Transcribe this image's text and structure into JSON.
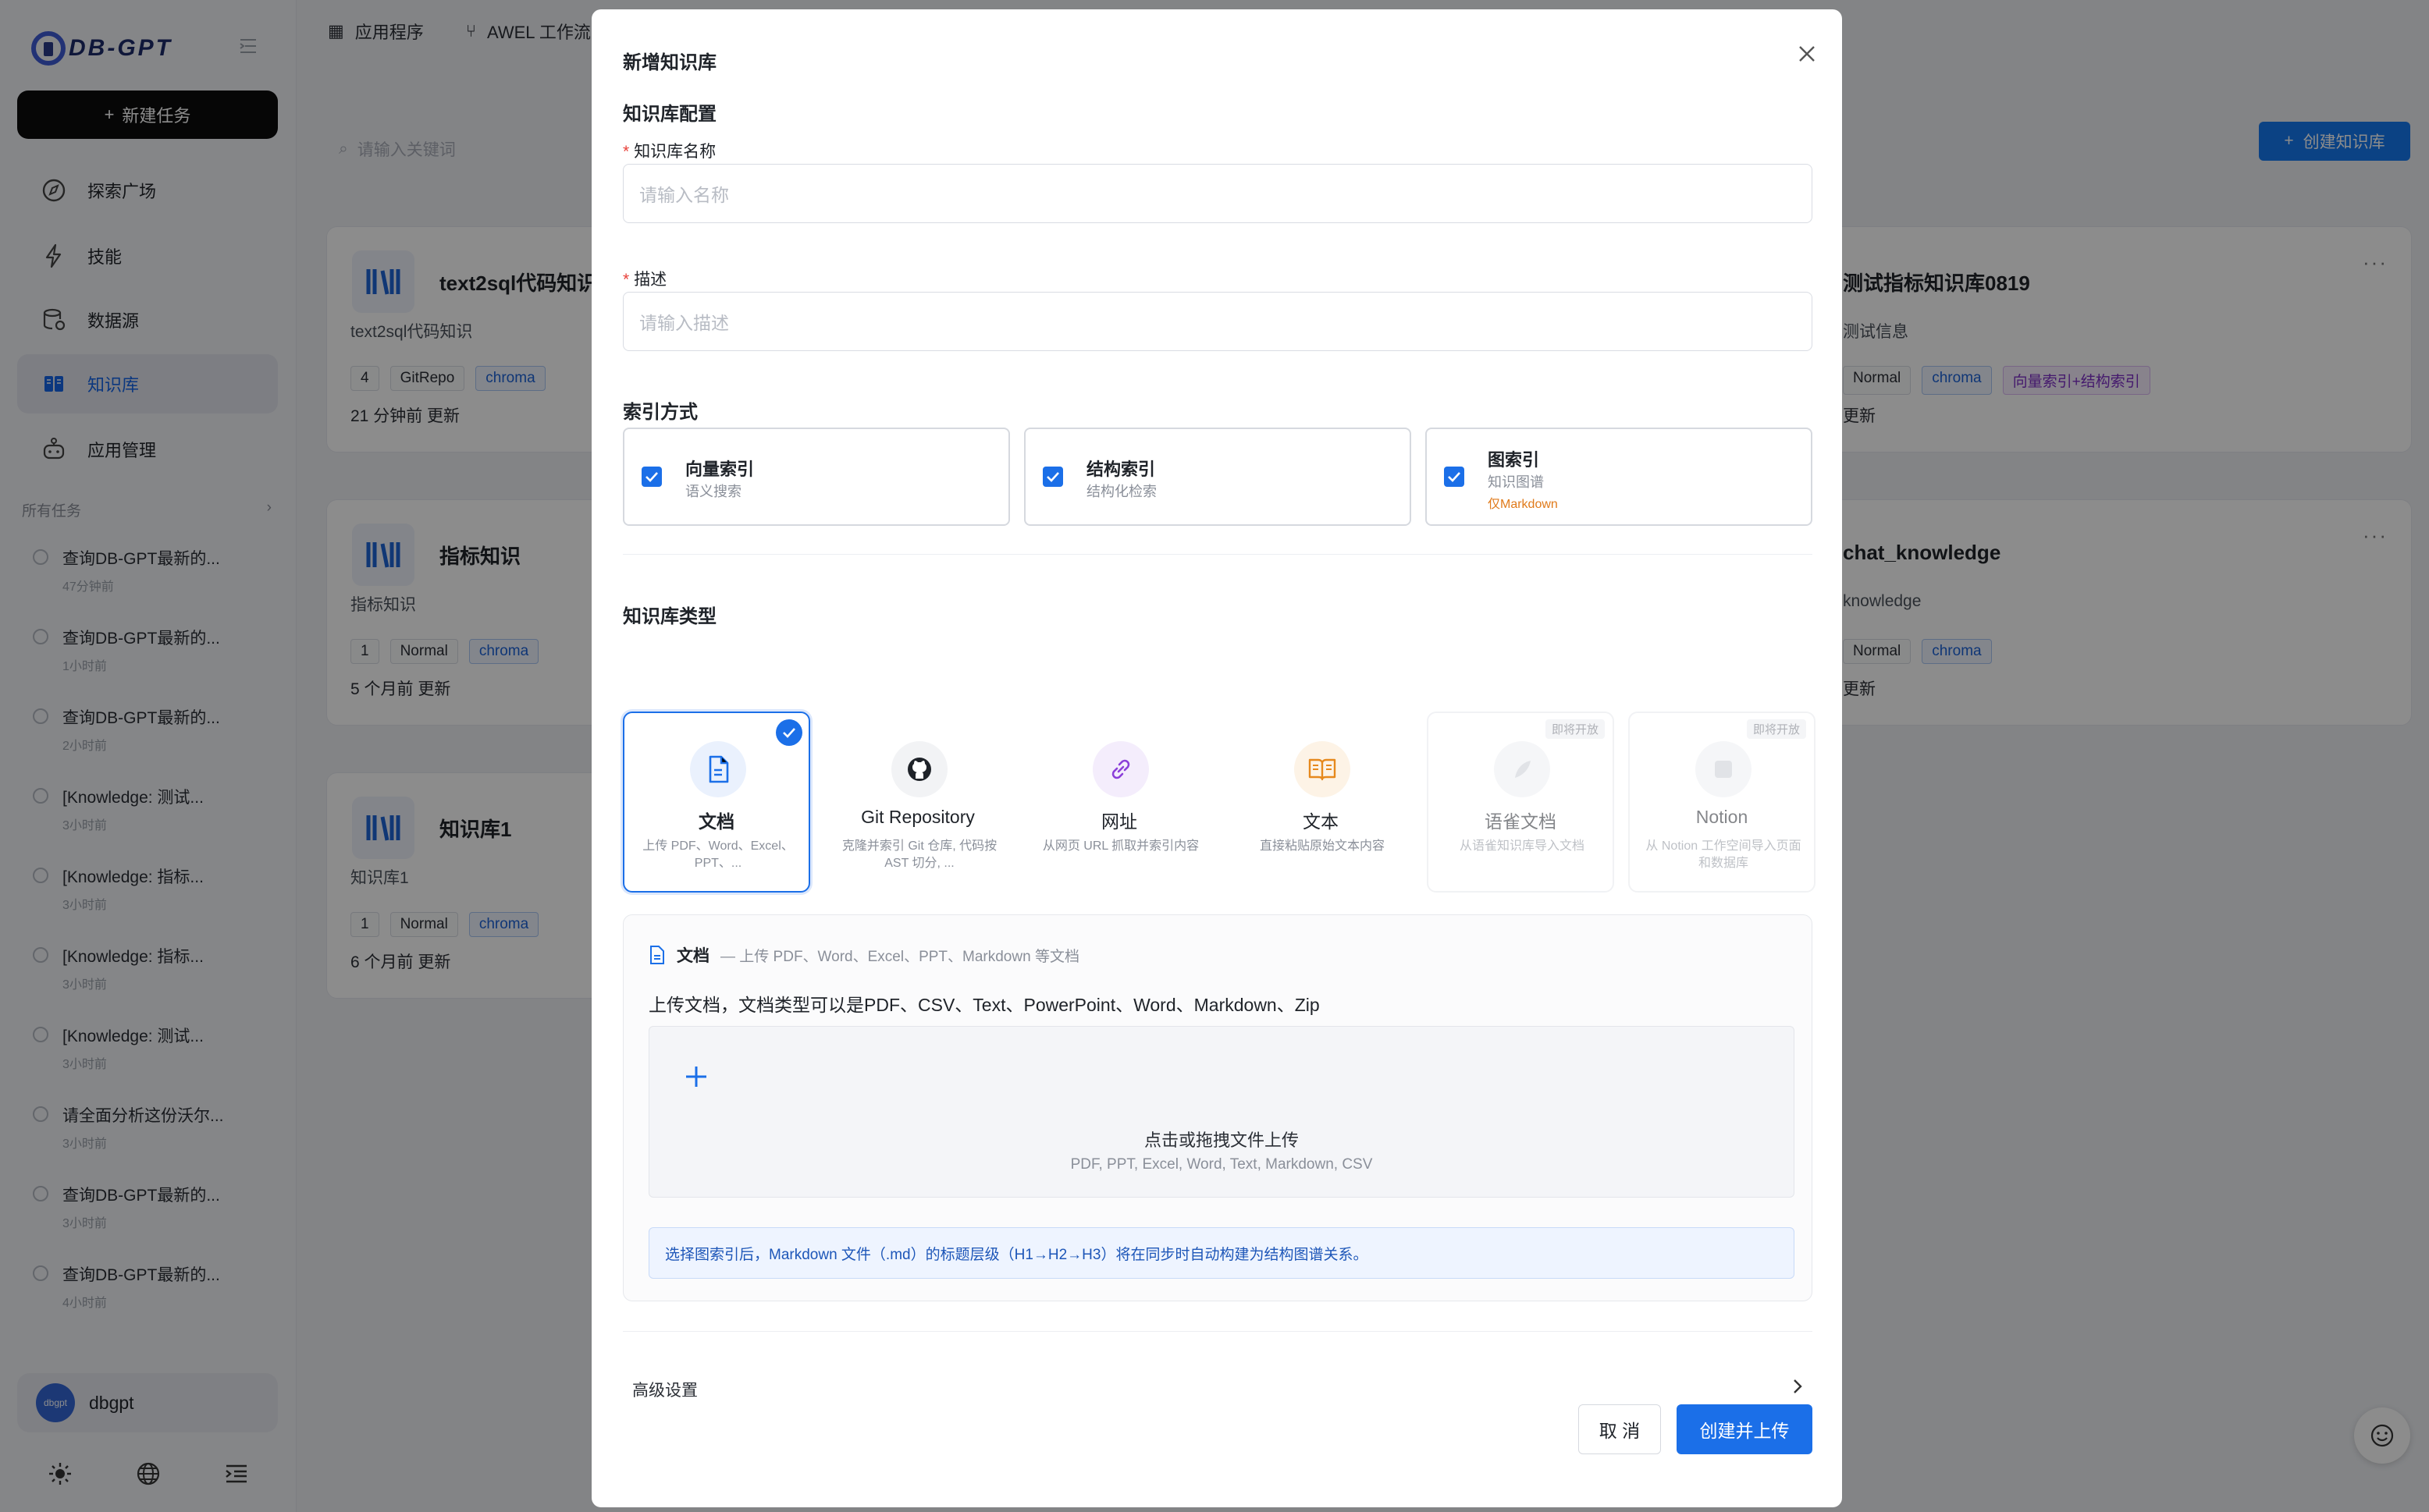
{
  "sidebar": {
    "logo_text": "DB-GPT",
    "new_task_label": "新建任务",
    "nav": [
      {
        "label": "探索广场",
        "icon": "compass-icon"
      },
      {
        "label": "技能",
        "icon": "lightning-icon"
      },
      {
        "label": "数据源",
        "icon": "database-icon"
      },
      {
        "label": "知识库",
        "icon": "book-icon",
        "active": true
      },
      {
        "label": "应用管理",
        "icon": "robot-icon"
      }
    ],
    "tasks_header": "所有任务",
    "tasks": [
      {
        "title": "查询DB-GPT最新的...",
        "time": "47分钟前"
      },
      {
        "title": "查询DB-GPT最新的...",
        "time": "1小时前"
      },
      {
        "title": "查询DB-GPT最新的...",
        "time": "2小时前"
      },
      {
        "title": "[Knowledge: 测试...",
        "time": "3小时前"
      },
      {
        "title": "[Knowledge: 指标...",
        "time": "3小时前"
      },
      {
        "title": "[Knowledge: 指标...",
        "time": "3小时前"
      },
      {
        "title": "[Knowledge: 测试...",
        "time": "3小时前"
      },
      {
        "title": "请全面分析这份沃尔...",
        "time": "3小时前"
      },
      {
        "title": "查询DB-GPT最新的...",
        "time": "3小时前"
      },
      {
        "title": "查询DB-GPT最新的...",
        "time": "4小时前"
      }
    ],
    "user": {
      "avatar_text": "dbgpt",
      "name": "dbgpt"
    }
  },
  "topnav": {
    "apps": "应用程序",
    "awel": "AWEL 工作流"
  },
  "page": {
    "search_placeholder": "请输入关键词",
    "create_button": "创建知识库",
    "cards": [
      {
        "name": "text2sql代码知识",
        "desc": "text2sql代码知识",
        "tags": [
          "4",
          "GitRepo",
          "chroma"
        ],
        "updated": "21 分钟前 更新"
      },
      {
        "name": "测试指标知识库0819",
        "desc": "测试信息",
        "tags": [
          "Normal",
          "chroma",
          "向量索引+结构索引"
        ],
        "updated": "更新"
      },
      {
        "name": "指标知识",
        "desc": "指标知识",
        "tags": [
          "1",
          "Normal",
          "chroma"
        ],
        "updated": "5 个月前 更新"
      },
      {
        "name": "chat_knowledge",
        "desc": "knowledge",
        "tags": [
          "Normal",
          "chroma"
        ],
        "updated": "更新"
      },
      {
        "name": "知识库1",
        "desc": "知识库1",
        "tags": [
          "1",
          "Normal",
          "chroma"
        ],
        "updated": "6 个月前 更新"
      }
    ]
  },
  "modal": {
    "title": "新增知识库",
    "config_section": "知识库配置",
    "name_label": "知识库名称",
    "name_placeholder": "请输入名称",
    "desc_label": "描述",
    "desc_placeholder": "请输入描述",
    "index_section": "索引方式",
    "index_options": [
      {
        "title": "向量索引",
        "sub": "语义搜索",
        "checked": true
      },
      {
        "title": "结构索引",
        "sub": "结构化检索",
        "checked": true
      },
      {
        "title": "图索引",
        "sub": "知识图谱",
        "note": "仅Markdown",
        "checked": true
      }
    ],
    "type_section": "知识库类型",
    "types": [
      {
        "name": "文档",
        "desc": "上传 PDF、Word、Excel、PPT、...",
        "icon": "document-icon",
        "selected": true
      },
      {
        "name": "Git Repository",
        "desc": "克隆并索引 Git 仓库, 代码按 AST 切分, ...",
        "icon": "github-icon"
      },
      {
        "name": "网址",
        "desc": "从网页 URL 抓取并索引内容",
        "icon": "link-icon"
      },
      {
        "name": "文本",
        "desc": "直接粘贴原始文本内容",
        "icon": "open-book-icon"
      },
      {
        "name": "语雀文档",
        "desc": "从语雀知识库导入文档",
        "icon": "yuque-icon",
        "badge": "即将开放",
        "disabled": true
      },
      {
        "name": "Notion",
        "desc": "从 Notion 工作空间导入页面和数据库",
        "icon": "notion-icon",
        "badge": "即将开放",
        "disabled": true
      }
    ],
    "panel": {
      "title": "文档",
      "subtitle": "— 上传 PDF、Word、Excel、PPT、Markdown 等文档",
      "hint": "上传文档，文档类型可以是PDF、CSV、Text、PowerPoint、Word、Markdown、Zip",
      "drop_title": "点击或拖拽文件上传",
      "drop_desc": "PDF, PPT, Excel, Word, Text, Markdown, CSV",
      "info": "选择图索引后，Markdown 文件（.md）的标题层级（H1→H2→H3）将在同步时自动构建为结构图谱关系。"
    },
    "advanced_label": "高级设置",
    "cancel_label": "取 消",
    "submit_label": "创建并上传"
  },
  "colors": {
    "primary": "#1b6fe8",
    "dark_button": "#0b0b0c",
    "required": "#e8423b",
    "warning_note": "#e07a1a"
  }
}
